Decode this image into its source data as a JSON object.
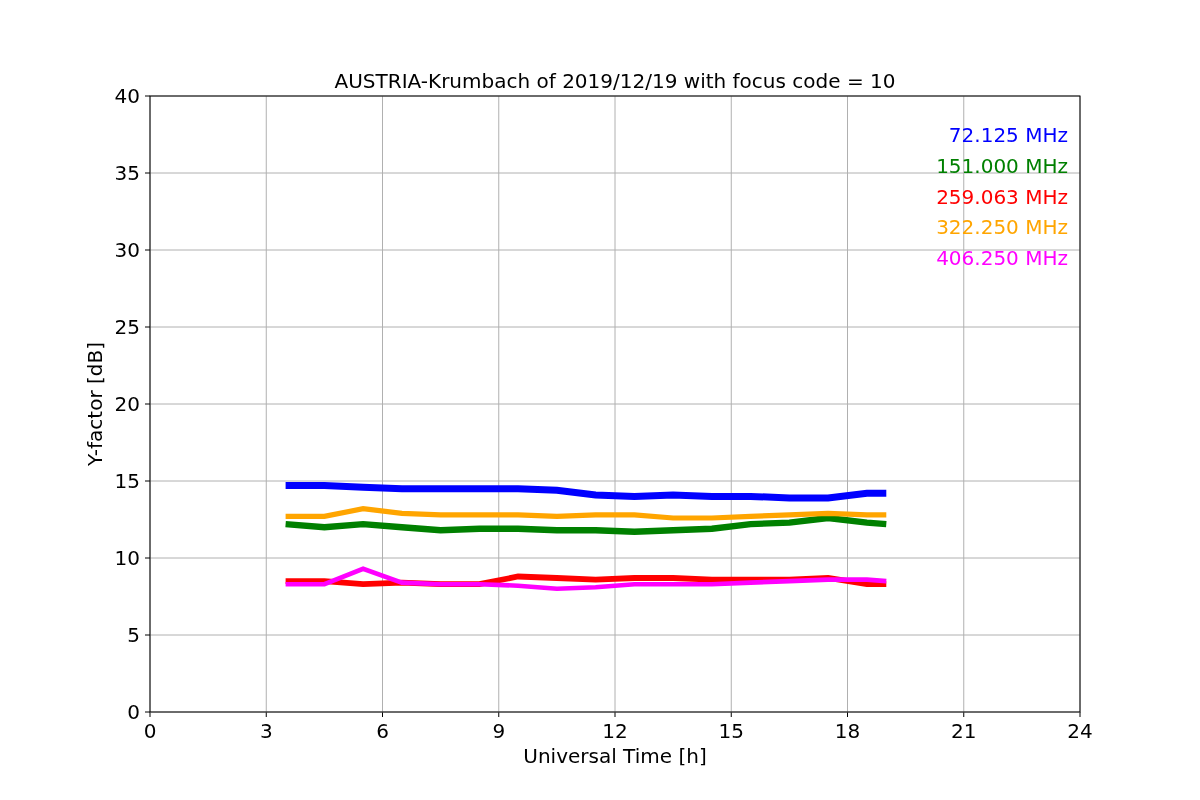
{
  "chart_data": {
    "type": "line",
    "title": "AUSTRIA-Krumbach of 2019/12/19 with focus code = 10",
    "xlabel": "Universal Time [h]",
    "ylabel": "Y-factor [dB]",
    "x": [
      3.5,
      4.5,
      5.5,
      6.5,
      7.5,
      8.5,
      9.5,
      10.5,
      11.5,
      12.5,
      13.5,
      14.5,
      15.5,
      16.5,
      17.5,
      18.5,
      19
    ],
    "series": [
      {
        "name": "72.125 MHz",
        "color": "#0000ff",
        "values": [
          14.7,
          14.7,
          14.6,
          14.5,
          14.5,
          14.5,
          14.5,
          14.4,
          14.1,
          14.0,
          14.1,
          14.0,
          14.0,
          13.9,
          13.9,
          14.2,
          14.2
        ]
      },
      {
        "name": "151.000 MHz",
        "color": "#008000",
        "values": [
          12.2,
          12.0,
          12.2,
          12.0,
          11.8,
          11.9,
          11.9,
          11.8,
          11.8,
          11.7,
          11.8,
          11.9,
          12.2,
          12.3,
          12.6,
          12.3,
          12.2
        ]
      },
      {
        "name": "259.063 MHz",
        "color": "#ff0000",
        "values": [
          8.5,
          8.5,
          8.3,
          8.4,
          8.3,
          8.3,
          8.8,
          8.7,
          8.6,
          8.7,
          8.7,
          8.6,
          8.6,
          8.6,
          8.7,
          8.3,
          8.3
        ]
      },
      {
        "name": "322.250 MHz",
        "color": "#ffa500",
        "values": [
          12.7,
          12.7,
          13.2,
          12.9,
          12.8,
          12.8,
          12.8,
          12.7,
          12.8,
          12.8,
          12.6,
          12.6,
          12.7,
          12.8,
          12.9,
          12.8,
          12.8
        ]
      },
      {
        "name": "406.250 MHz",
        "color": "#ff00ff",
        "values": [
          8.3,
          8.3,
          9.3,
          8.4,
          8.3,
          8.3,
          8.2,
          8.0,
          8.1,
          8.3,
          8.3,
          8.3,
          8.4,
          8.5,
          8.6,
          8.6,
          8.5
        ]
      }
    ],
    "grid": true,
    "xlim": [
      0,
      24
    ],
    "ylim": [
      0,
      40
    ],
    "xticks": [
      0,
      3,
      6,
      9,
      12,
      15,
      18,
      21,
      24
    ],
    "yticks": [
      0,
      5,
      10,
      15,
      20,
      25,
      30,
      35,
      40
    ]
  }
}
